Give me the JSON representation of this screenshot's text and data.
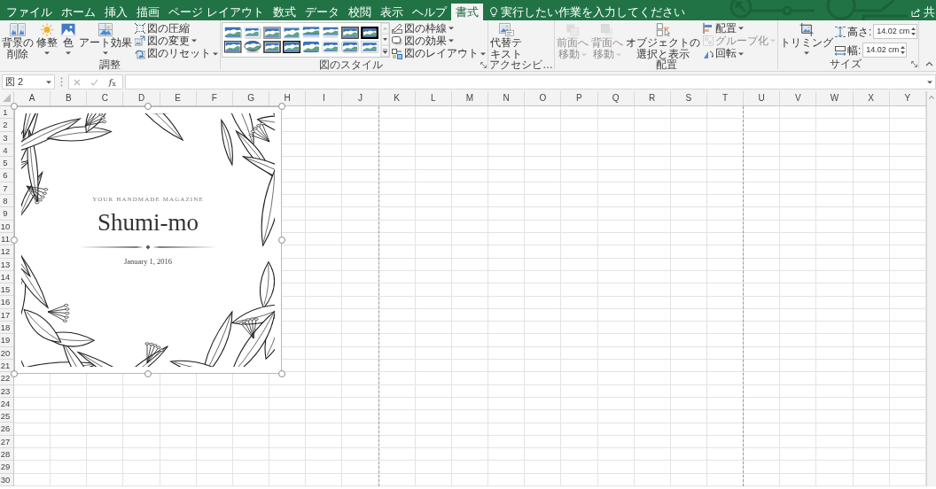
{
  "tabs": [
    {
      "label": "ファイル",
      "selected": false
    },
    {
      "label": "ホーム",
      "selected": false
    },
    {
      "label": "挿入",
      "selected": false
    },
    {
      "label": "描画",
      "selected": false
    },
    {
      "label": "ページ レイアウト",
      "selected": false
    },
    {
      "label": "数式",
      "selected": false
    },
    {
      "label": "データ",
      "selected": false
    },
    {
      "label": "校閲",
      "selected": false
    },
    {
      "label": "表示",
      "selected": false
    },
    {
      "label": "ヘルプ",
      "selected": false
    },
    {
      "label": "書式",
      "selected": true
    }
  ],
  "tell_me": {
    "text": "実行したい作業を入力してください"
  },
  "share": {
    "label": "共"
  },
  "ribbon": {
    "groups": [
      {
        "label": "調整",
        "launcher": false,
        "items": [
          {
            "kind": "large",
            "lines": [
              "背景の",
              "削除"
            ],
            "dropdown": false,
            "disabled": false
          },
          {
            "kind": "large",
            "lines": [
              "修整"
            ],
            "dropdown": true,
            "disabled": false
          },
          {
            "kind": "large",
            "lines": [
              "色"
            ],
            "dropdown": true,
            "disabled": false
          },
          {
            "kind": "large",
            "lines": [
              "アート効果"
            ],
            "dropdown": true,
            "disabled": false
          },
          {
            "kind": "stack",
            "buttons": [
              {
                "label": "図の圧縮",
                "dropdown": false,
                "disabled": false
              },
              {
                "label": "図の変更",
                "dropdown": true,
                "disabled": false
              },
              {
                "label": "図のリセット",
                "dropdown": true,
                "disabled": false
              }
            ]
          }
        ]
      },
      {
        "label": "図のスタイル",
        "launcher": true,
        "items": [
          {
            "kind": "gallery"
          },
          {
            "kind": "stack",
            "buttons": [
              {
                "label": "図の枠線",
                "dropdown": true,
                "disabled": false
              },
              {
                "label": "図の効果",
                "dropdown": true,
                "disabled": false
              },
              {
                "label": "図のレイアウト",
                "dropdown": true,
                "disabled": false
              }
            ]
          }
        ]
      },
      {
        "label": "アクセシビ…",
        "launcher": false,
        "items": [
          {
            "kind": "large",
            "lines": [
              "代替テ",
              "キスト"
            ],
            "dropdown": false,
            "disabled": false
          }
        ]
      },
      {
        "label": "配置",
        "launcher": false,
        "items": [
          {
            "kind": "large",
            "lines": [
              "前面へ",
              "移動"
            ],
            "dropdown": true,
            "disabled": true
          },
          {
            "kind": "large",
            "lines": [
              "背面へ",
              "移動"
            ],
            "dropdown": true,
            "disabled": true
          },
          {
            "kind": "large",
            "lines": [
              "オブジェクトの",
              "選択と表示"
            ],
            "dropdown": false,
            "disabled": false
          },
          {
            "kind": "stack",
            "buttons": [
              {
                "label": "配置",
                "dropdown": true,
                "disabled": false
              },
              {
                "label": "グループ化",
                "dropdown": true,
                "disabled": true
              },
              {
                "label": "回転",
                "dropdown": true,
                "disabled": false
              }
            ]
          }
        ]
      },
      {
        "label": "サイズ",
        "launcher": true,
        "items": [
          {
            "kind": "large",
            "lines": [
              "トリミング"
            ],
            "dropdown": true,
            "disabled": false
          },
          {
            "kind": "size_fields",
            "fields": [
              {
                "label": "高さ:",
                "value": "14.02 cm"
              },
              {
                "label": "幅:",
                "value": "14.02 cm"
              }
            ]
          }
        ]
      }
    ]
  },
  "formula_bar": {
    "name_box": "図 2",
    "function_button": "*f*$_{x}$"
  },
  "columns": [
    {
      "label": "A",
      "page_break": false
    },
    {
      "label": "B",
      "page_break": false
    },
    {
      "label": "C",
      "page_break": false
    },
    {
      "label": "D",
      "page_break": false
    },
    {
      "label": "E",
      "page_break": false
    },
    {
      "label": "F",
      "page_break": false
    },
    {
      "label": "G",
      "page_break": false
    },
    {
      "label": "H",
      "page_break": false
    },
    {
      "label": "I",
      "page_break": false
    },
    {
      "label": "J",
      "page_break": true
    },
    {
      "label": "K",
      "page_break": false
    },
    {
      "label": "L",
      "page_break": false
    },
    {
      "label": "M",
      "page_break": false
    },
    {
      "label": "N",
      "page_break": false
    },
    {
      "label": "O",
      "page_break": false
    },
    {
      "label": "P",
      "page_break": false
    },
    {
      "label": "Q",
      "page_break": false
    },
    {
      "label": "R",
      "page_break": false
    },
    {
      "label": "S",
      "page_break": false
    },
    {
      "label": "T",
      "page_break": true
    },
    {
      "label": "U",
      "page_break": false
    },
    {
      "label": "V",
      "page_break": false
    },
    {
      "label": "W",
      "page_break": false
    },
    {
      "label": "X",
      "page_break": false
    },
    {
      "label": "Y",
      "page_break": false
    }
  ],
  "rows": [
    "1",
    "2",
    "3",
    "4",
    "5",
    "6",
    "7",
    "8",
    "9",
    "10",
    "11",
    "12",
    "13",
    "14",
    "15",
    "16",
    "17",
    "18",
    "19",
    "20",
    "21",
    "22",
    "23",
    "24",
    "25",
    "26",
    "27",
    "28",
    "29",
    "30"
  ],
  "picture": {
    "selected": true,
    "tagline": "YOUR HANDMADE MAGAZINE",
    "title": "Shumi-mo",
    "date": "January 1, 2016"
  }
}
